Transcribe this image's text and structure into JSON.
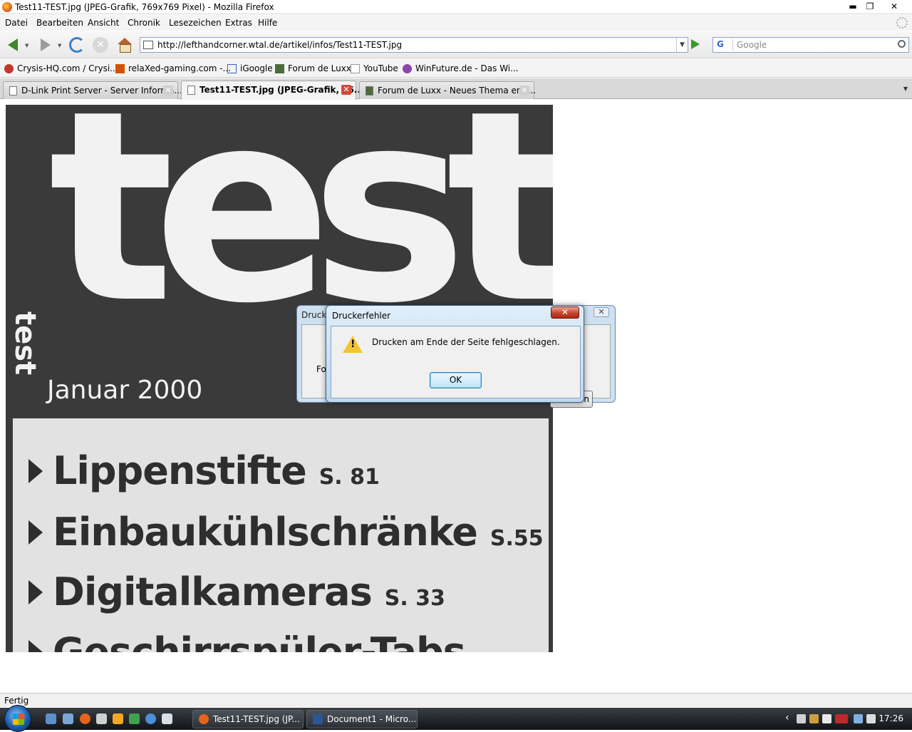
{
  "window": {
    "title": "Test11-TEST.jpg (JPEG-Grafik, 769x769 Pixel) - Mozilla Firefox",
    "minimize_glyph": "▬",
    "maximize_glyph": "❐",
    "close_glyph": "✕"
  },
  "menu": {
    "items": [
      "Datei",
      "Bearbeiten",
      "Ansicht",
      "Chronik",
      "Lesezeichen",
      "Extras",
      "Hilfe"
    ]
  },
  "navigation": {
    "url": "http://lefthandcorner.wtal.de/artikel/infos/Test11-TEST.jpg",
    "url_dropdown_glyph": "▼",
    "search_engine_glyph": "G",
    "search_placeholder": "Google",
    "back_dropdown_glyph": "▼",
    "forward_dropdown_glyph": "▼",
    "stop_glyph": "✕"
  },
  "bookmarks": [
    {
      "label": "Crysis-HQ.com / Crysi...",
      "icon": "crysis-icon",
      "color": "#c0392b"
    },
    {
      "label": "relaXed-gaming.com -...",
      "icon": "relaxed-icon",
      "color": "#d35400"
    },
    {
      "label": "iGoogle",
      "icon": "igoogle-icon",
      "color": "#3366cc"
    },
    {
      "label": "Forum de Luxx",
      "icon": "luxx-icon",
      "color": "#4d6b3a"
    },
    {
      "label": "YouTube",
      "icon": "youtube-page-icon",
      "color": "#999999"
    },
    {
      "label": "WinFuture.de - Das Wi...",
      "icon": "winfuture-icon",
      "color": "#8e44ad"
    }
  ],
  "tabs": [
    {
      "label": "D-Link Print Server - Server Informa...",
      "active": false
    },
    {
      "label": "Test11-TEST.jpg (JPEG-Grafik, 76...",
      "active": true
    },
    {
      "label": "Forum de Luxx - Neues Thema erst...",
      "active": false
    }
  ],
  "tabs_close_glyph": "✕",
  "tabs_list_glyph": "▼",
  "magazine": {
    "logo_text": "test",
    "side_logo": "test",
    "date": "Januar 2000",
    "topics": [
      {
        "title": "Lippenstifte",
        "page": "S. 81"
      },
      {
        "title": "Einbaukühlschränke",
        "page": "S.55"
      },
      {
        "title": "Digitalkameras",
        "page": "S. 33"
      },
      {
        "title": "Geschirrspüler-Tabs",
        "page": ""
      }
    ]
  },
  "back_dialog": {
    "title_fragment": "Drucke",
    "text_fragment": "Fort",
    "button_fragment": "en",
    "close_glyph": "✕"
  },
  "error_dialog": {
    "title": "Druckerfehler",
    "message": "Drucken am Ende der Seite fehlgeschlagen.",
    "ok_label": "OK",
    "close_glyph": "✕",
    "warning_glyph": "!"
  },
  "status": {
    "text": "Fertig"
  },
  "taskbar": {
    "buttons": [
      {
        "label": "Test11-TEST.jpg (JP...",
        "icon_color": "#e5631b"
      },
      {
        "label": "Document1 - Micro...",
        "icon_color": "#2b5797"
      }
    ],
    "tray_arrow_glyph": "‹",
    "clock": "17:26"
  }
}
